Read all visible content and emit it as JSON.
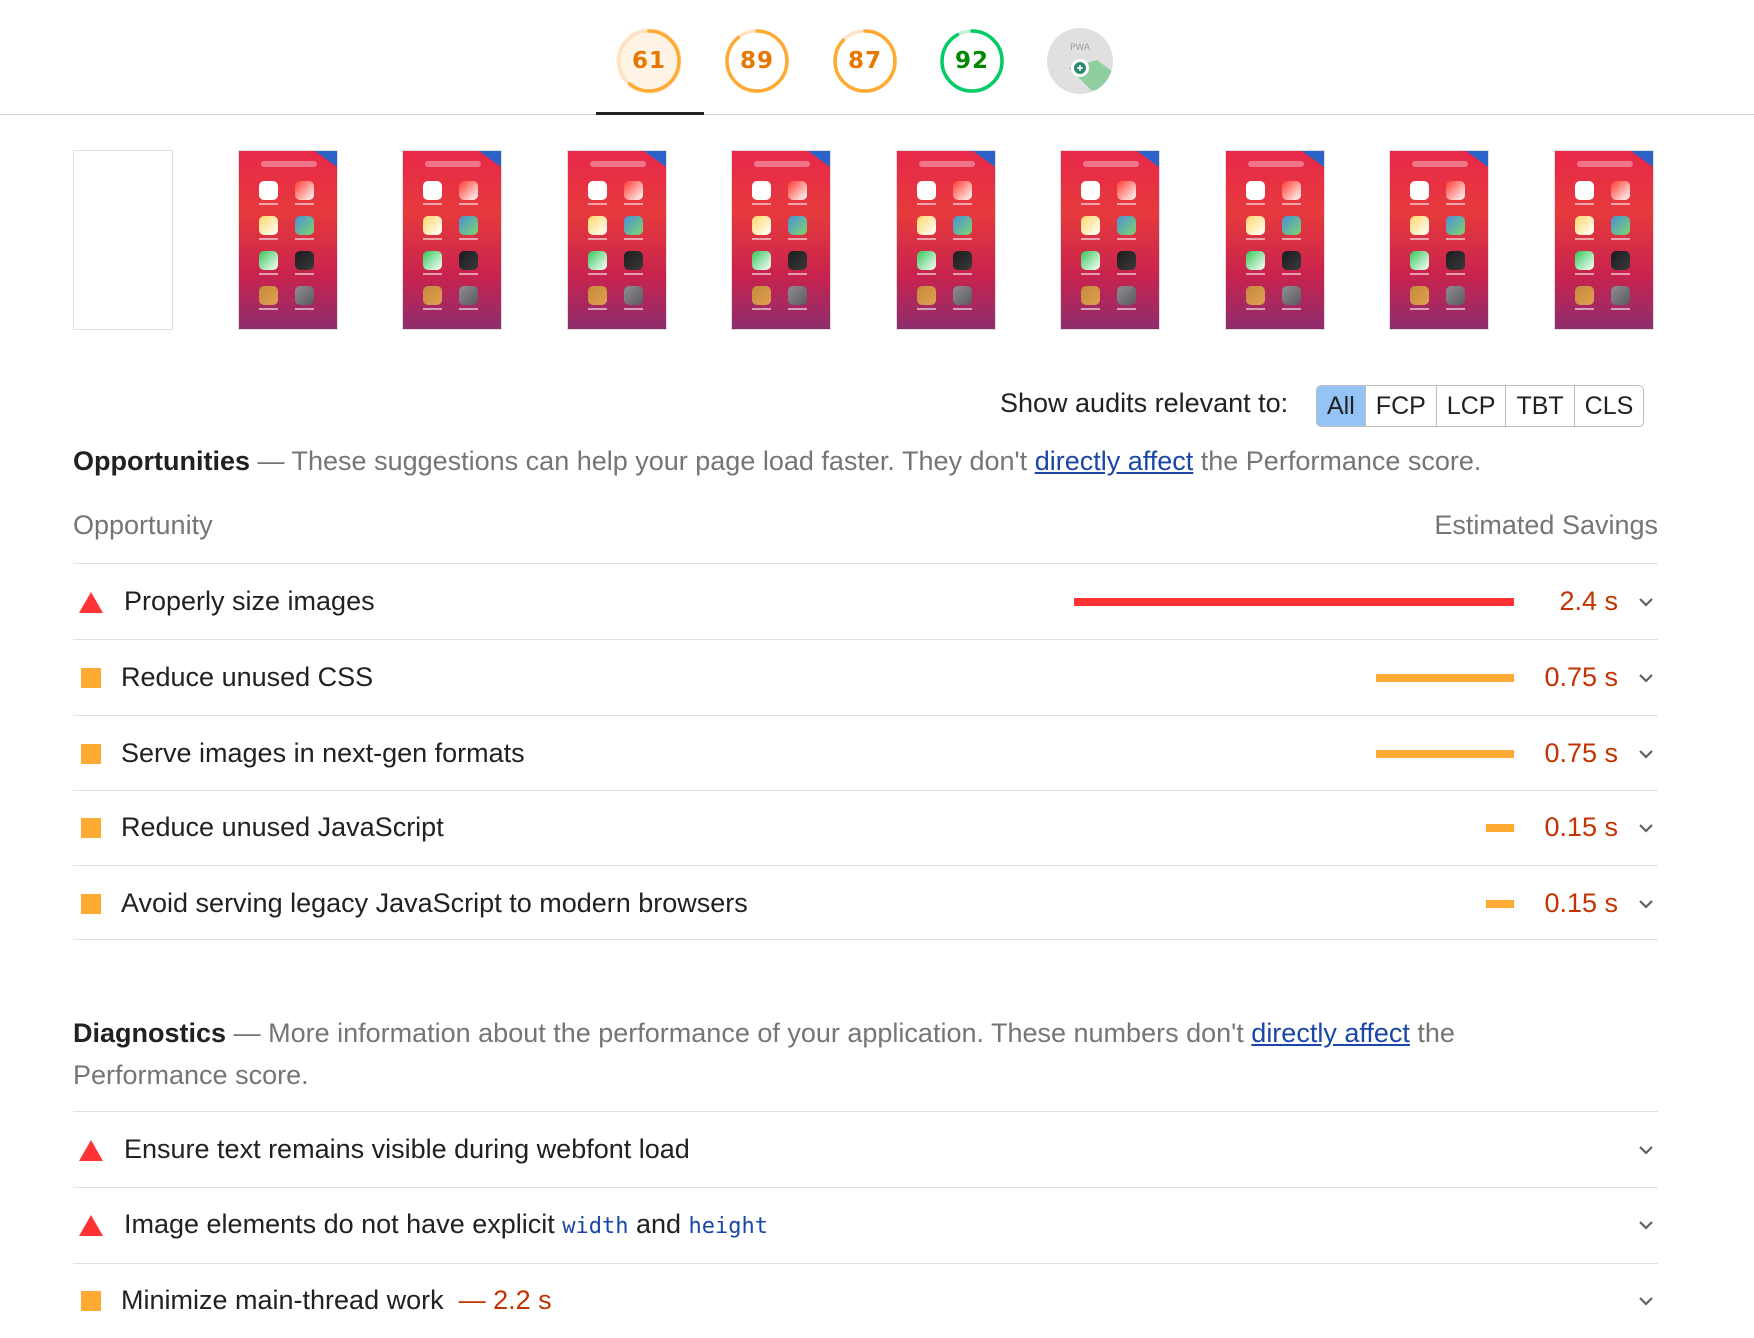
{
  "scores": [
    {
      "value": "61",
      "color": "#fa3"
    },
    {
      "value": "89",
      "color": "#fa3"
    },
    {
      "value": "87",
      "color": "#fa3"
    },
    {
      "value": "92",
      "color": "#0c6"
    }
  ],
  "pwa_label": "PWA",
  "filter": {
    "label": "Show audits relevant to:",
    "options": [
      "All",
      "FCP",
      "LCP",
      "TBT",
      "CLS"
    ],
    "selected": "All"
  },
  "opportunities": {
    "title": "Opportunities",
    "dash": "—",
    "description_before": "These suggestions can help your page load faster. They don't ",
    "link": "directly affect",
    "description_after": " the Performance score.",
    "col_opportunity": "Opportunity",
    "col_savings": "Estimated Savings",
    "items": [
      {
        "title": "Properly size images",
        "savings": "2.4 s",
        "severity": "fail",
        "savings_value": 2.4
      },
      {
        "title": "Reduce unused CSS",
        "savings": "0.75 s",
        "severity": "average",
        "savings_value": 0.75
      },
      {
        "title": "Serve images in next-gen formats",
        "savings": "0.75 s",
        "severity": "average",
        "savings_value": 0.75
      },
      {
        "title": "Reduce unused JavaScript",
        "savings": "0.15 s",
        "severity": "average",
        "savings_value": 0.15
      },
      {
        "title": "Avoid serving legacy JavaScript to modern browsers",
        "savings": "0.15 s",
        "severity": "average",
        "savings_value": 0.15
      }
    ]
  },
  "diagnostics": {
    "title": "Diagnostics",
    "dash": "—",
    "description_before": "More information about the performance of your application. These numbers don't ",
    "link": "directly affect",
    "description_after_line1": " the",
    "description_line2": "Performance score.",
    "items": [
      {
        "title": "Ensure text remains visible during webfont load",
        "severity": "fail"
      },
      {
        "title_before": "Image elements do not have explicit ",
        "code1": "width",
        "title_mid": " and ",
        "code2": "height",
        "severity": "fail"
      },
      {
        "title": "Minimize main-thread work",
        "inline_value": "— 2.2 s",
        "severity": "average"
      }
    ]
  },
  "colors": {
    "fail": "#f33",
    "average": "#fa3",
    "pass": "#0c6",
    "link": "#1a46a8"
  }
}
